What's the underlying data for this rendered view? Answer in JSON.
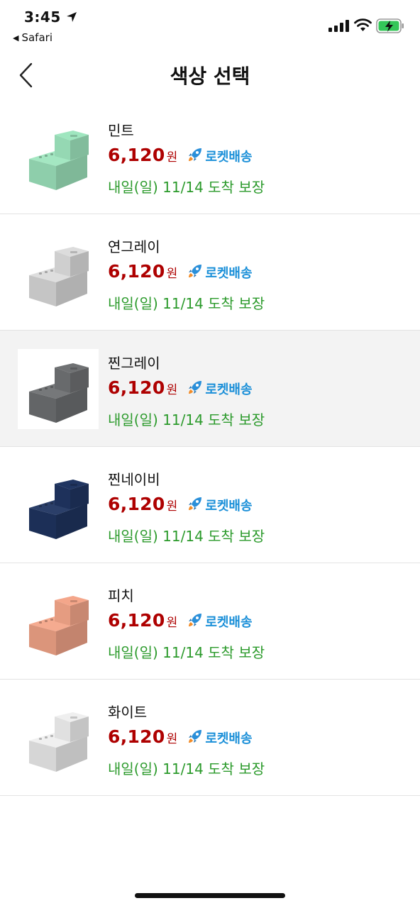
{
  "status_bar": {
    "time": "3:45",
    "back_app": "Safari"
  },
  "header": {
    "title": "색상 선택"
  },
  "items": [
    {
      "name": "민트",
      "price": "6,120",
      "currency": "원",
      "badge": "로켓배송",
      "delivery": "내일(일) 11/14 도착 보장",
      "color": "#9fe6bf",
      "selected": false
    },
    {
      "name": "연그레이",
      "price": "6,120",
      "currency": "원",
      "badge": "로켓배송",
      "delivery": "내일(일) 11/14 도착 보장",
      "color": "#dcdcdc",
      "selected": false
    },
    {
      "name": "찐그레이",
      "price": "6,120",
      "currency": "원",
      "badge": "로켓배송",
      "delivery": "내일(일) 11/14 도착 보장",
      "color": "#6f7173",
      "selected": true
    },
    {
      "name": "찐네이비",
      "price": "6,120",
      "currency": "원",
      "badge": "로켓배송",
      "delivery": "내일(일) 11/14 도착 보장",
      "color": "#203561",
      "selected": false
    },
    {
      "name": "피치",
      "price": "6,120",
      "currency": "원",
      "badge": "로켓배송",
      "delivery": "내일(일) 11/14 도착 보장",
      "color": "#f4a68a",
      "selected": false
    },
    {
      "name": "화이트",
      "price": "6,120",
      "currency": "원",
      "badge": "로켓배송",
      "delivery": "내일(일) 11/14 도착 보장",
      "color": "#efefef",
      "selected": false
    }
  ],
  "colors": {
    "price": "#ae0000",
    "rocket_badge": "#1a8fd8",
    "delivery": "#2b9a2b",
    "selected_row_bg": "#f3f3f3"
  }
}
